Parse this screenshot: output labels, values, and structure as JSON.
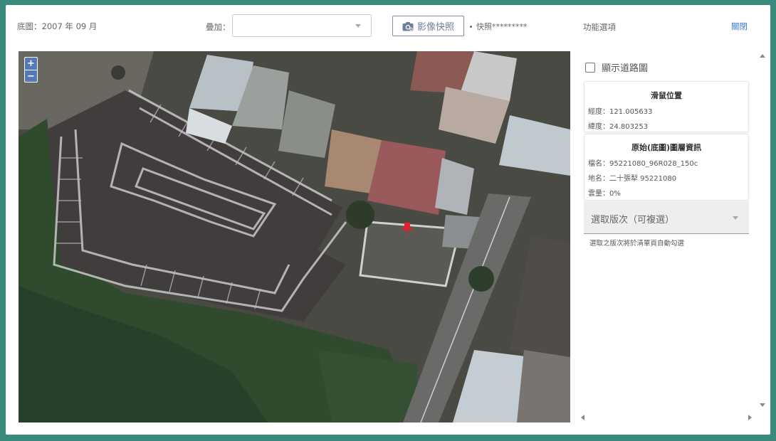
{
  "header": {
    "base_map_label": "底圖：2007 年 09 月",
    "overlay_label": "疊加：",
    "overlay_value": "",
    "snapshot_button_label": "影像快照",
    "snapshot_info": "快照*********",
    "function_options_label": "功能選項",
    "close_label": "關閉"
  },
  "map": {
    "zoom_in": "+",
    "zoom_out": "−",
    "marker_icon": "red-pushpin-icon"
  },
  "side_panel": {
    "show_road_map_label": "顯示道路圖",
    "show_road_map_checked": false,
    "mouse_position": {
      "title": "滑鼠位置",
      "longitude": "經度：121.005633",
      "latitude": "緯度：24.803253"
    },
    "layer_info": {
      "title": "原始(底圖)圖層資訊",
      "file_name": "檔名：95221080_96R028_150c",
      "place_name": "地名：二十張犁 95221080",
      "cloud_cover": "雲量：0%"
    },
    "version_select": {
      "label": "選取版次（可複選）"
    },
    "hint": "選取之版次將於清單頁自動勾選"
  },
  "colors": {
    "frame": "#3a8a7e",
    "accent_link": "#3a7bd5",
    "zoom_button": "#5579b8",
    "marker": "#e8202a"
  }
}
